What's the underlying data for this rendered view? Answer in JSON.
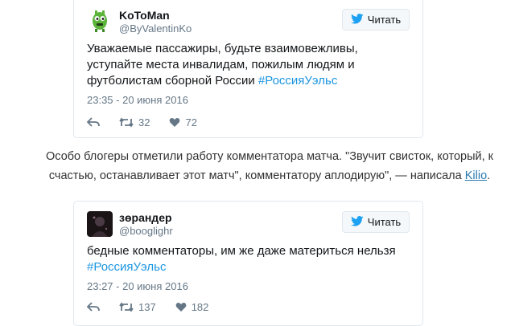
{
  "colors": {
    "link_blue": "#1b95e0",
    "twitter_blue": "#1da1f2",
    "muted": "#657786",
    "border": "#e1e8ed"
  },
  "tweets": [
    {
      "display_name": "KoToMan",
      "handle": "@ByValentinKo",
      "avatar_icon": "green-monster-avatar",
      "follow_label": "Читать",
      "text_before": "Уважаемые пассажиры, будьте взаимовежливы, уступайте места инвалидам, пожилым людям и футболистам сборной России ",
      "hashtag": "#РоссияУэльс",
      "text_after": "",
      "timestamp": "23:35 - 20 июня 2016",
      "retweets": "32",
      "likes": "72"
    },
    {
      "display_name": "зөрандер",
      "handle": "@booglighr",
      "avatar_icon": "dark-figure-avatar",
      "follow_label": "Читать",
      "text_before": "бедные комментаторы, им же даже материться нельзя",
      "hashtag": "#РоссияУэльс",
      "text_after": "",
      "timestamp": "23:27 - 20 июня 2016",
      "retweets": "137",
      "likes": "182"
    }
  ],
  "article": {
    "paragraph_text": "Особо блогеры отметили работу комментатора матча. \"Звучит свисток, который, к счастью, останавливает этот матч\", комментатору аплодирую\", — написала ",
    "link_text": "Kilio",
    "trailing": "."
  }
}
